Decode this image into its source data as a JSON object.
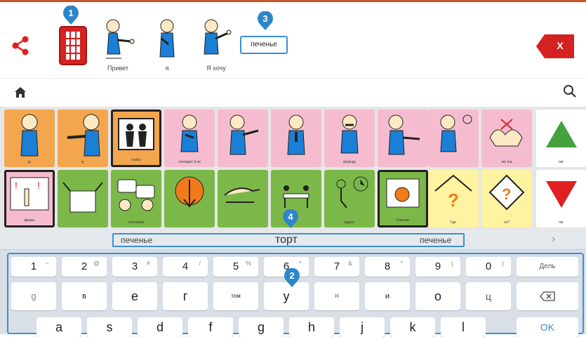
{
  "header": {
    "board_badge": "1",
    "sentence_badge": "3",
    "sentence_box": "печенье",
    "sentence_words": [
      "Привет",
      "я",
      "Я хочу"
    ],
    "delete_label": "X"
  },
  "grid": {
    "row1": [
      {
        "label": "ja",
        "color": "orange"
      },
      {
        "label": "ty",
        "color": "orange"
      },
      {
        "label": "osoby",
        "color": "orange"
      },
      {
        "label": "rozmijam 3 ml",
        "color": "pink"
      },
      {
        "label": "",
        "color": "pink"
      },
      {
        "label": "",
        "color": "pink"
      },
      {
        "label": "dziękuję",
        "color": "pink"
      },
      {
        "label": "",
        "color": "pink"
      },
      {
        "label": "",
        "color": "pink"
      },
      {
        "label": "nie ma",
        "color": "pink"
      },
      {
        "label": "tak",
        "color": "white"
      }
    ],
    "row2": [
      {
        "label": "фразы",
        "color": "pink"
      },
      {
        "label": "",
        "color": "green"
      },
      {
        "label": "rozmowas",
        "color": "green"
      },
      {
        "label": "",
        "color": "green"
      },
      {
        "label": "",
        "color": "green"
      },
      {
        "label": "",
        "color": "green"
      },
      {
        "label": "ждать",
        "color": "green"
      },
      {
        "label": "Глаголы",
        "color": "green"
      },
      {
        "label": "Где",
        "color": "yellow"
      },
      {
        "label": "co?",
        "color": "yellow"
      },
      {
        "label": "nie",
        "color": "white"
      }
    ]
  },
  "suggestions": {
    "left": "печенье",
    "center": "торт",
    "right": "печенье",
    "badge": "4",
    "arrow": "›"
  },
  "keyboard": {
    "badge": "2",
    "row1": [
      {
        "k": "1",
        "s": "~"
      },
      {
        "k": "2",
        "s": "@"
      },
      {
        "k": "3",
        "s": "#"
      },
      {
        "k": "4",
        "s": "/"
      },
      {
        "k": "5",
        "s": "%"
      },
      {
        "k": "6",
        "s": "^"
      },
      {
        "k": "7",
        "s": "&"
      },
      {
        "k": "8",
        "s": "*"
      },
      {
        "k": "9",
        "s": "("
      },
      {
        "k": "0",
        "s": ")"
      },
      {
        "k": "Дель",
        "s": ""
      }
    ],
    "row2": [
      "g",
      "в",
      "е",
      "г",
      "том",
      "у",
      "н",
      "и",
      "о",
      "ц"
    ],
    "row3": [
      "а",
      "s",
      "d",
      "f",
      "g",
      "h",
      "j",
      "k",
      "l",
      "OK"
    ]
  }
}
